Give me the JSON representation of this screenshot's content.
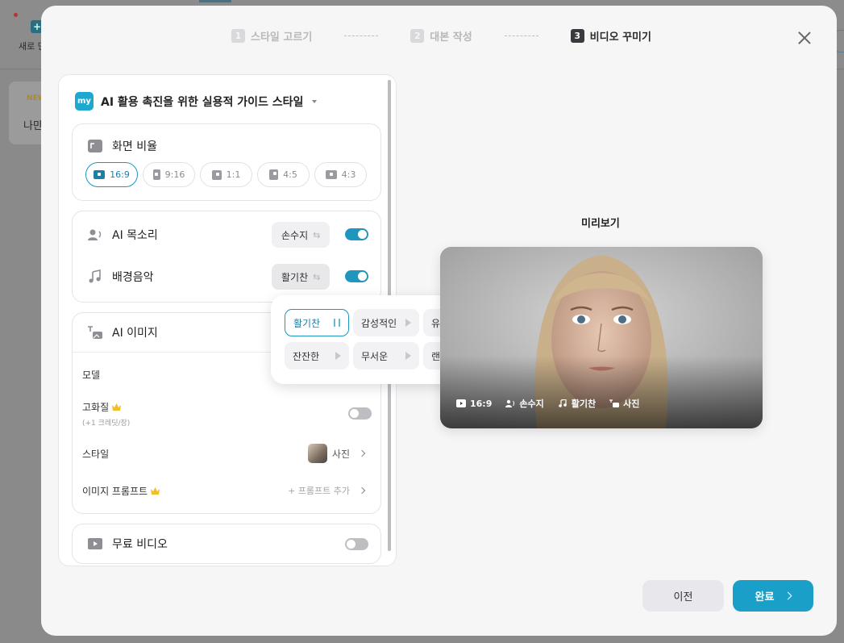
{
  "background": {
    "new_label": "새로 만",
    "new_icon": "+",
    "card_badge": "NEW",
    "card_text": "나만"
  },
  "stepper": {
    "steps": [
      {
        "num": "1",
        "label": "스타일 고르기"
      },
      {
        "num": "2",
        "label": "대본 작성"
      },
      {
        "num": "3",
        "label": "비디오 꾸미기"
      }
    ]
  },
  "panel": {
    "style_badge": "my",
    "style_name": "AI 활용 촉진을 위한 실용적 가이드 스타일",
    "ratio": {
      "title": "화면 비율",
      "options": [
        "16:9",
        "9:16",
        "1:1",
        "4:5",
        "4:3"
      ],
      "selected": "16:9"
    },
    "voice": {
      "title": "AI 목소리",
      "value": "손수지",
      "enabled": true
    },
    "music": {
      "title": "배경음악",
      "value": "활기찬",
      "enabled": true
    },
    "image": {
      "title": "AI 이미지",
      "model_label": "모델",
      "hq_label": "고화질",
      "hq_sub": "(+1 크레딧/장)",
      "hq_enabled": false,
      "style_label": "스타일",
      "style_value": "사진",
      "prompt_label": "이미지 프롬프트",
      "prompt_action": "+ 프롬프트 추가"
    },
    "free_video": {
      "title": "무료 비디오",
      "enabled": false
    }
  },
  "music_options": [
    {
      "label": "활기찬",
      "selected": true
    },
    {
      "label": "감성적인",
      "selected": false
    },
    {
      "label": "유쾌한",
      "selected": false
    },
    {
      "label": "잔잔한",
      "selected": false
    },
    {
      "label": "무서운",
      "selected": false
    },
    {
      "label": "랜덤",
      "selected": false
    }
  ],
  "preview": {
    "title": "미리보기",
    "tags": {
      "ratio": "16:9",
      "voice": "손수지",
      "music": "활기찬",
      "image": "사진"
    }
  },
  "footer": {
    "prev": "이전",
    "done": "완료"
  },
  "colors": {
    "accent": "#1aa0c8",
    "selected_border": "#1e96bd"
  }
}
